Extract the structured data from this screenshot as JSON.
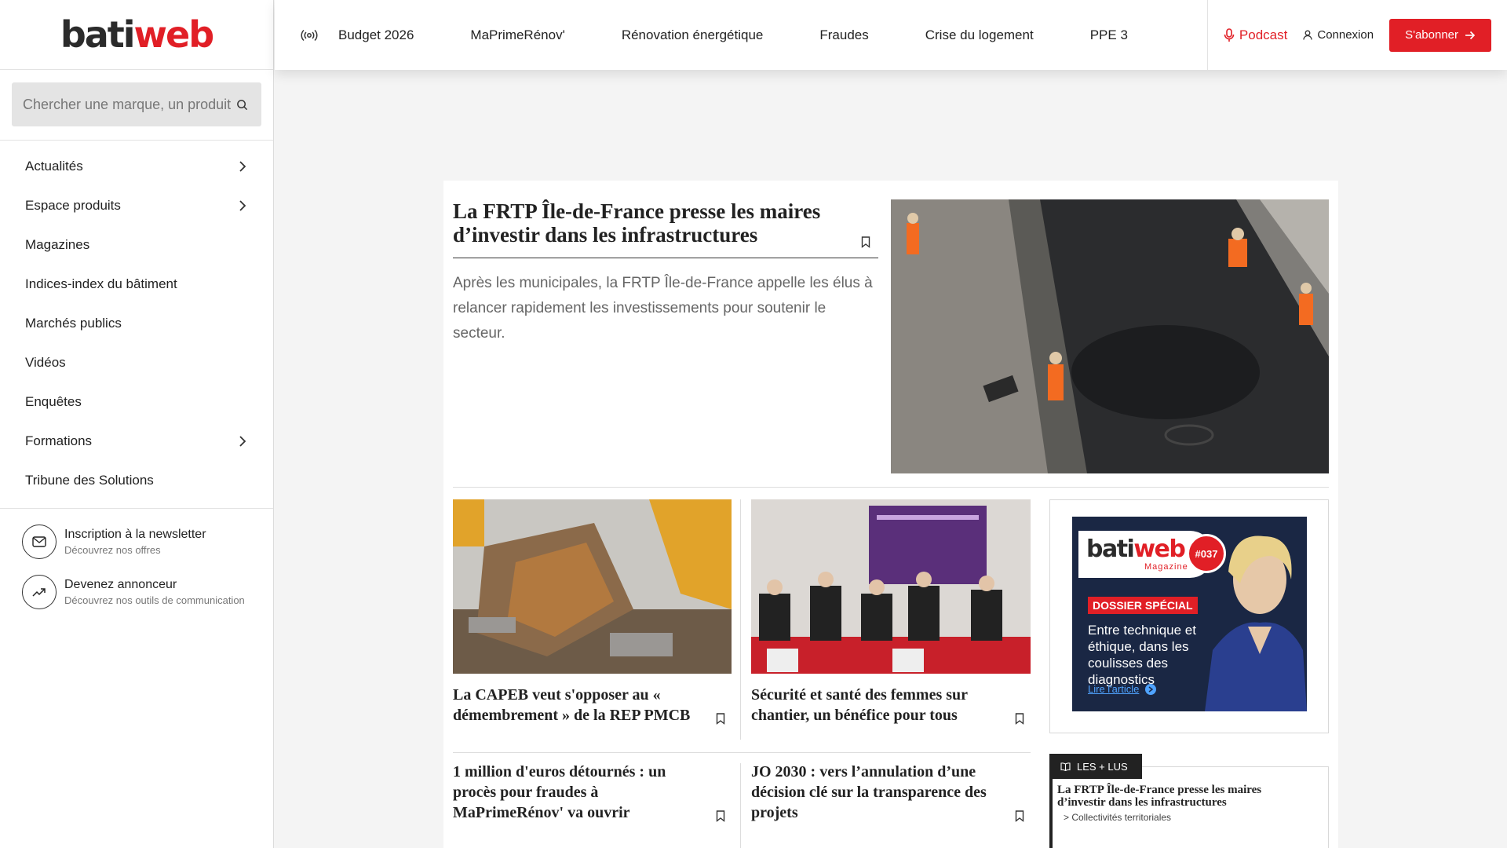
{
  "brand": {
    "part1": "bati",
    "part2": "web",
    "accent": "#e11f26"
  },
  "search": {
    "placeholder": "Chercher une marque, un produit"
  },
  "sidebar": {
    "items": [
      {
        "label": "Actualités",
        "has_children": true
      },
      {
        "label": "Espace produits",
        "has_children": true
      },
      {
        "label": "Magazines",
        "has_children": false
      },
      {
        "label": "Indices-index du bâtiment",
        "has_children": false
      },
      {
        "label": "Marchés publics",
        "has_children": false
      },
      {
        "label": "Vidéos",
        "has_children": false
      },
      {
        "label": "Enquêtes",
        "has_children": false
      },
      {
        "label": "Formations",
        "has_children": true
      },
      {
        "label": "Tribune des Solutions",
        "has_children": false
      }
    ],
    "promos": [
      {
        "icon": "mail-icon",
        "title": "Inscription à la newsletter",
        "subtitle": "Découvrez nos offres"
      },
      {
        "icon": "trending-up-icon",
        "title": "Devenez annonceur",
        "subtitle": "Découvrez nos outils de communication"
      }
    ]
  },
  "topnav": {
    "items": [
      "Budget 2026",
      "MaPrimeRénov'",
      "Rénovation énergétique",
      "Fraudes",
      "Crise du logement",
      "PPE 3"
    ],
    "podcast": "Podcast",
    "login": "Connexion",
    "subscribe": "S'abonner"
  },
  "lead": {
    "title": "La FRTP Île-de-France presse les maires d’investir dans les infrastructures",
    "description": "Après les municipales, la FRTP Île-de-France appelle les élus à relancer rapidement les investissements pour soutenir le secteur."
  },
  "cards": [
    {
      "title": "La CAPEB veut s'opposer au « démembrement » de la REP PMCB"
    },
    {
      "title": "Sécurité et santé des femmes sur chantier, un bénéfice pour tous"
    },
    {
      "title": "1 million d'euros détournés : un procès pour fraudes à MaPrimeRénov' va ouvrir"
    },
    {
      "title": "JO 2030 : vers l’annulation d’une décision clé sur la transparence des projets"
    }
  ],
  "ad": {
    "logo_part1": "bati",
    "logo_part2": "web",
    "magazine": "Magazine",
    "issue": "#037",
    "badge": "DOSSIER SPÉCIAL",
    "text": "Entre technique et éthique, dans les coulisses des diagnostics",
    "link": "Lire l'article"
  },
  "most_read": {
    "tab": "LES + LUS",
    "items": [
      {
        "title": "La FRTP Île-de-France presse les maires d’investir dans les infrastructures",
        "category": "> Collectivités territoriales"
      }
    ]
  }
}
